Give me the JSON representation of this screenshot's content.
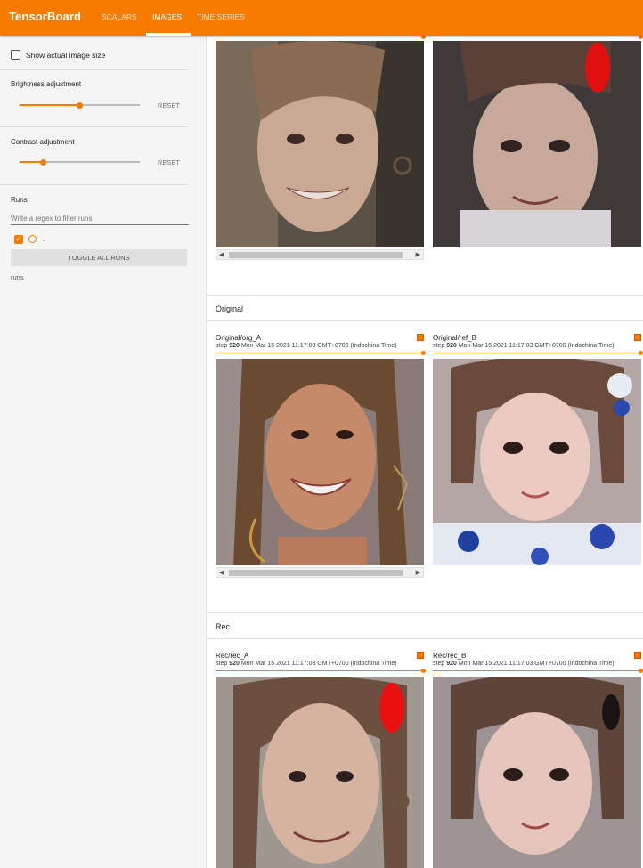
{
  "app": {
    "title": "TensorBoard",
    "tabs": [
      {
        "label": "SCALARS",
        "active": false
      },
      {
        "label": "IMAGES",
        "active": true
      },
      {
        "label": "TIME SERIES",
        "active": false
      }
    ]
  },
  "sidebar": {
    "show_actual_size": {
      "label": "Show actual image size",
      "checked": false
    },
    "brightness": {
      "title": "Brightness adjustment",
      "value": 0.5,
      "reset": "RESET"
    },
    "contrast": {
      "title": "Contrast adjustment",
      "value": 0.2,
      "reset": "RESET"
    },
    "runs": {
      "title": "Runs",
      "filter_placeholder": "Write a regex to filter runs",
      "items": [
        {
          "label": ".",
          "checked": true
        }
      ],
      "toggle_all": "TOGGLE ALL RUNS",
      "footer": "runs"
    }
  },
  "sections": [
    {
      "name": "",
      "cards": [
        {
          "title": "",
          "has_scrollbar": true
        },
        {
          "title": "",
          "has_scrollbar": false
        }
      ]
    },
    {
      "name": "Original",
      "cards": [
        {
          "title": "Original/org_A",
          "step_label": "step",
          "step": "920",
          "timestamp": "Mon Mar 15 2021 11:17:03 GMT+0700 (Indochina Time)",
          "has_scrollbar": true
        },
        {
          "title": "Original/ref_B",
          "step_label": "step",
          "step": "920",
          "timestamp": "Mon Mar 15 2021 11:17:03 GMT+0700 (Indochina Time)",
          "has_scrollbar": false
        }
      ]
    },
    {
      "name": "Rec",
      "cards": [
        {
          "title": "Rec/rec_A",
          "step_label": "step",
          "step": "920",
          "timestamp": "Mon Mar 15 2021 11:17:03 GMT+0700 (Indochina Time)",
          "has_scrollbar": false
        },
        {
          "title": "Rec/rec_B",
          "step_label": "step",
          "step": "920",
          "timestamp": "Mon Mar 15 2021 11:17:03 GMT+0700 (Indochina Time)",
          "has_scrollbar": false
        }
      ]
    }
  ],
  "colors": {
    "accent": "#f57c00",
    "sidebar_bg": "#f5f5f5"
  }
}
